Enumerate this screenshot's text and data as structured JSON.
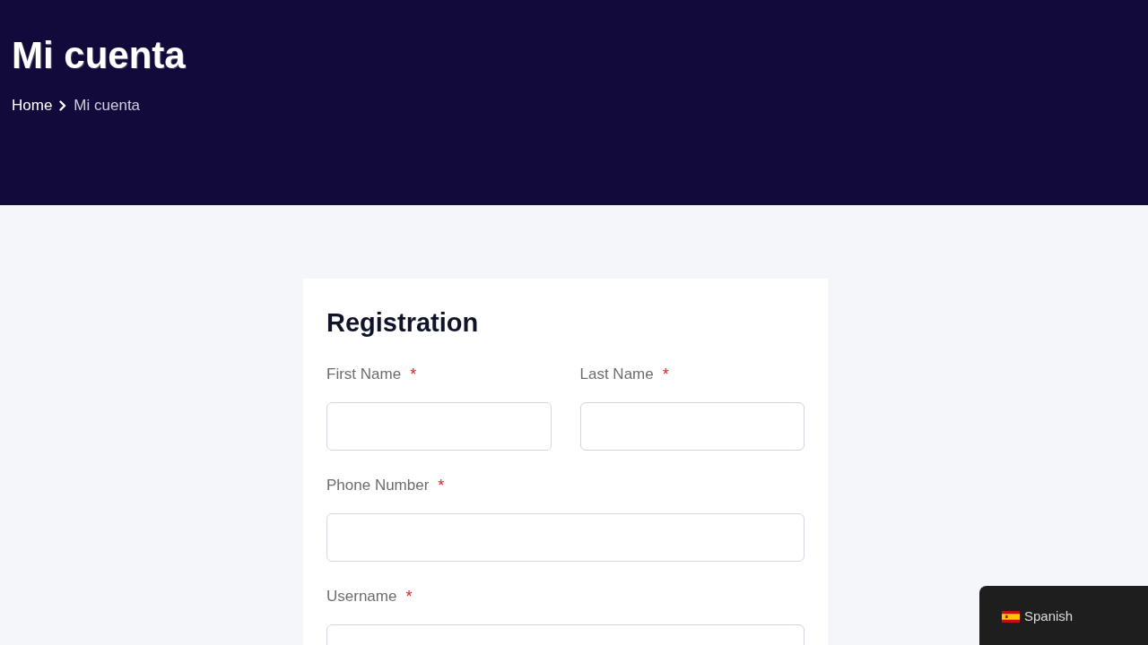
{
  "page_header": {
    "title": "Mi cuenta",
    "breadcrumb": [
      {
        "label": "Home",
        "kind": "link"
      },
      {
        "label": "Mi cuenta",
        "kind": "current"
      }
    ]
  },
  "registration_form": {
    "title": "Registration",
    "rows": [
      {
        "fields": [
          {
            "label": "First Name",
            "required_mark": "*"
          },
          {
            "label": "Last Name",
            "required_mark": "*"
          }
        ]
      },
      {
        "fields": [
          {
            "label": "Phone Number",
            "required_mark": "*"
          }
        ]
      },
      {
        "fields": [
          {
            "label": "Username",
            "required_mark": "*"
          }
        ]
      }
    ]
  },
  "language_switcher": {
    "language": "Spanish"
  }
}
